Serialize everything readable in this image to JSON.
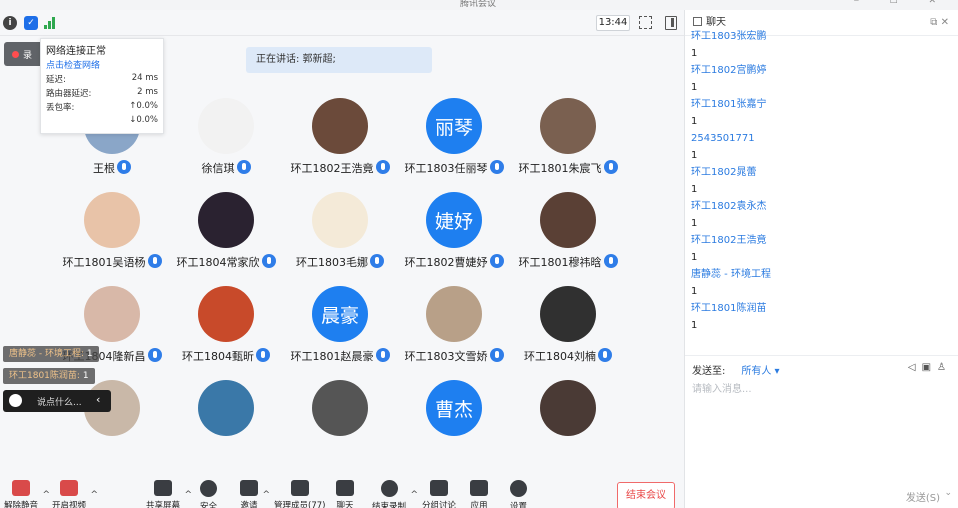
{
  "window": {
    "title": "腾讯会议",
    "controls": "⎯ ☐ ✕"
  },
  "topbar": {
    "time": "13:44"
  },
  "speaker": {
    "text": "正在讲话: 郭新超;"
  },
  "record": {
    "label": "录"
  },
  "network": {
    "title": "网络连接正常",
    "check_link": "点击检查网络",
    "rows": [
      {
        "label": "延迟:",
        "value": "24 ms"
      },
      {
        "label": "路由器延迟:",
        "value": "2 ms"
      },
      {
        "label": "丢包率:",
        "value": "↑0.0%"
      },
      {
        "label": "",
        "value": "↓0.0%"
      }
    ]
  },
  "participants": [
    {
      "name": "王根",
      "avatar_text": "",
      "color": "#8aa6c8"
    },
    {
      "name": "徐信琪",
      "avatar_text": "",
      "color": "#f2f2f2"
    },
    {
      "name": "环工1802王浩竟",
      "avatar_text": "",
      "color": "#6b4a3a"
    },
    {
      "name": "环工1803任丽琴",
      "avatar_text": "丽琴",
      "color": "#1e7ff0"
    },
    {
      "name": "环工1801朱宸飞",
      "avatar_text": "",
      "color": "#7a6050"
    },
    {
      "name": "环工1801吴语杨",
      "avatar_text": "",
      "color": "#e8c3a8"
    },
    {
      "name": "环工1804常家欣",
      "avatar_text": "",
      "color": "#2a2230"
    },
    {
      "name": "环工1803毛娜",
      "avatar_text": "",
      "color": "#f4ead8"
    },
    {
      "name": "环工1802曹婕妤",
      "avatar_text": "婕妤",
      "color": "#1e7ff0"
    },
    {
      "name": "环工1801穆祎晗",
      "avatar_text": "",
      "color": "#5a4035"
    },
    {
      "name": "环工1804隆新昌",
      "avatar_text": "",
      "color": "#d8b8a8"
    },
    {
      "name": "环工1804甄昕",
      "avatar_text": "",
      "color": "#c84a2a"
    },
    {
      "name": "环工1801赵晨豪",
      "avatar_text": "晨豪",
      "color": "#1e7ff0"
    },
    {
      "name": "环工1803文雪娇",
      "avatar_text": "",
      "color": "#b8a088"
    },
    {
      "name": "环工1804刘楠",
      "avatar_text": "",
      "color": "#303030"
    },
    {
      "name": "",
      "avatar_text": "",
      "color": "#c9b8a8"
    },
    {
      "name": "",
      "avatar_text": "",
      "color": "#3a78a8"
    },
    {
      "name": "",
      "avatar_text": "",
      "color": "#555555"
    },
    {
      "name": "",
      "avatar_text": "曹杰",
      "color": "#1e7ff0"
    },
    {
      "name": "",
      "avatar_text": "",
      "color": "#4a3a35"
    }
  ],
  "chips": [
    {
      "who": "唐静蕊 - 环境工程:",
      "val": "1"
    },
    {
      "who": "环工1801陈润苗:",
      "val": "1"
    }
  ],
  "quickchat": {
    "placeholder": "说点什么..."
  },
  "toolbar": [
    {
      "label": "解除静音"
    },
    {
      "label": "开启视频"
    },
    {
      "label": "共享屏幕"
    },
    {
      "label": "安全"
    },
    {
      "label": "邀请"
    },
    {
      "label": "管理成员(77)"
    },
    {
      "label": "聊天"
    },
    {
      "label": "结束录制"
    },
    {
      "label": "分组讨论"
    },
    {
      "label": "应用"
    },
    {
      "label": "设置"
    }
  ],
  "end_meeting": "结束会议",
  "chat": {
    "title": "聊天",
    "messages": [
      {
        "who": "环工1803张宏鹏",
        "text": "1"
      },
      {
        "who": "环工1802宫鹏婷",
        "text": "1"
      },
      {
        "who": "环工1801张嘉宁",
        "text": "1"
      },
      {
        "who": "2543501771",
        "text": "1"
      },
      {
        "who": "环工1802晁蕾",
        "text": "1"
      },
      {
        "who": "环工1802袁永杰",
        "text": "1"
      },
      {
        "who": "环工1802王浩竟",
        "text": "1"
      },
      {
        "who": "唐静蕊 - 环境工程",
        "text": "1"
      },
      {
        "who": "环工1801陈润苗",
        "text": "1"
      }
    ],
    "send_to_label": "发送至:",
    "send_to_value": "所有人 ▾",
    "input_placeholder": "请输入消息...",
    "send_button": "发送(S)"
  }
}
